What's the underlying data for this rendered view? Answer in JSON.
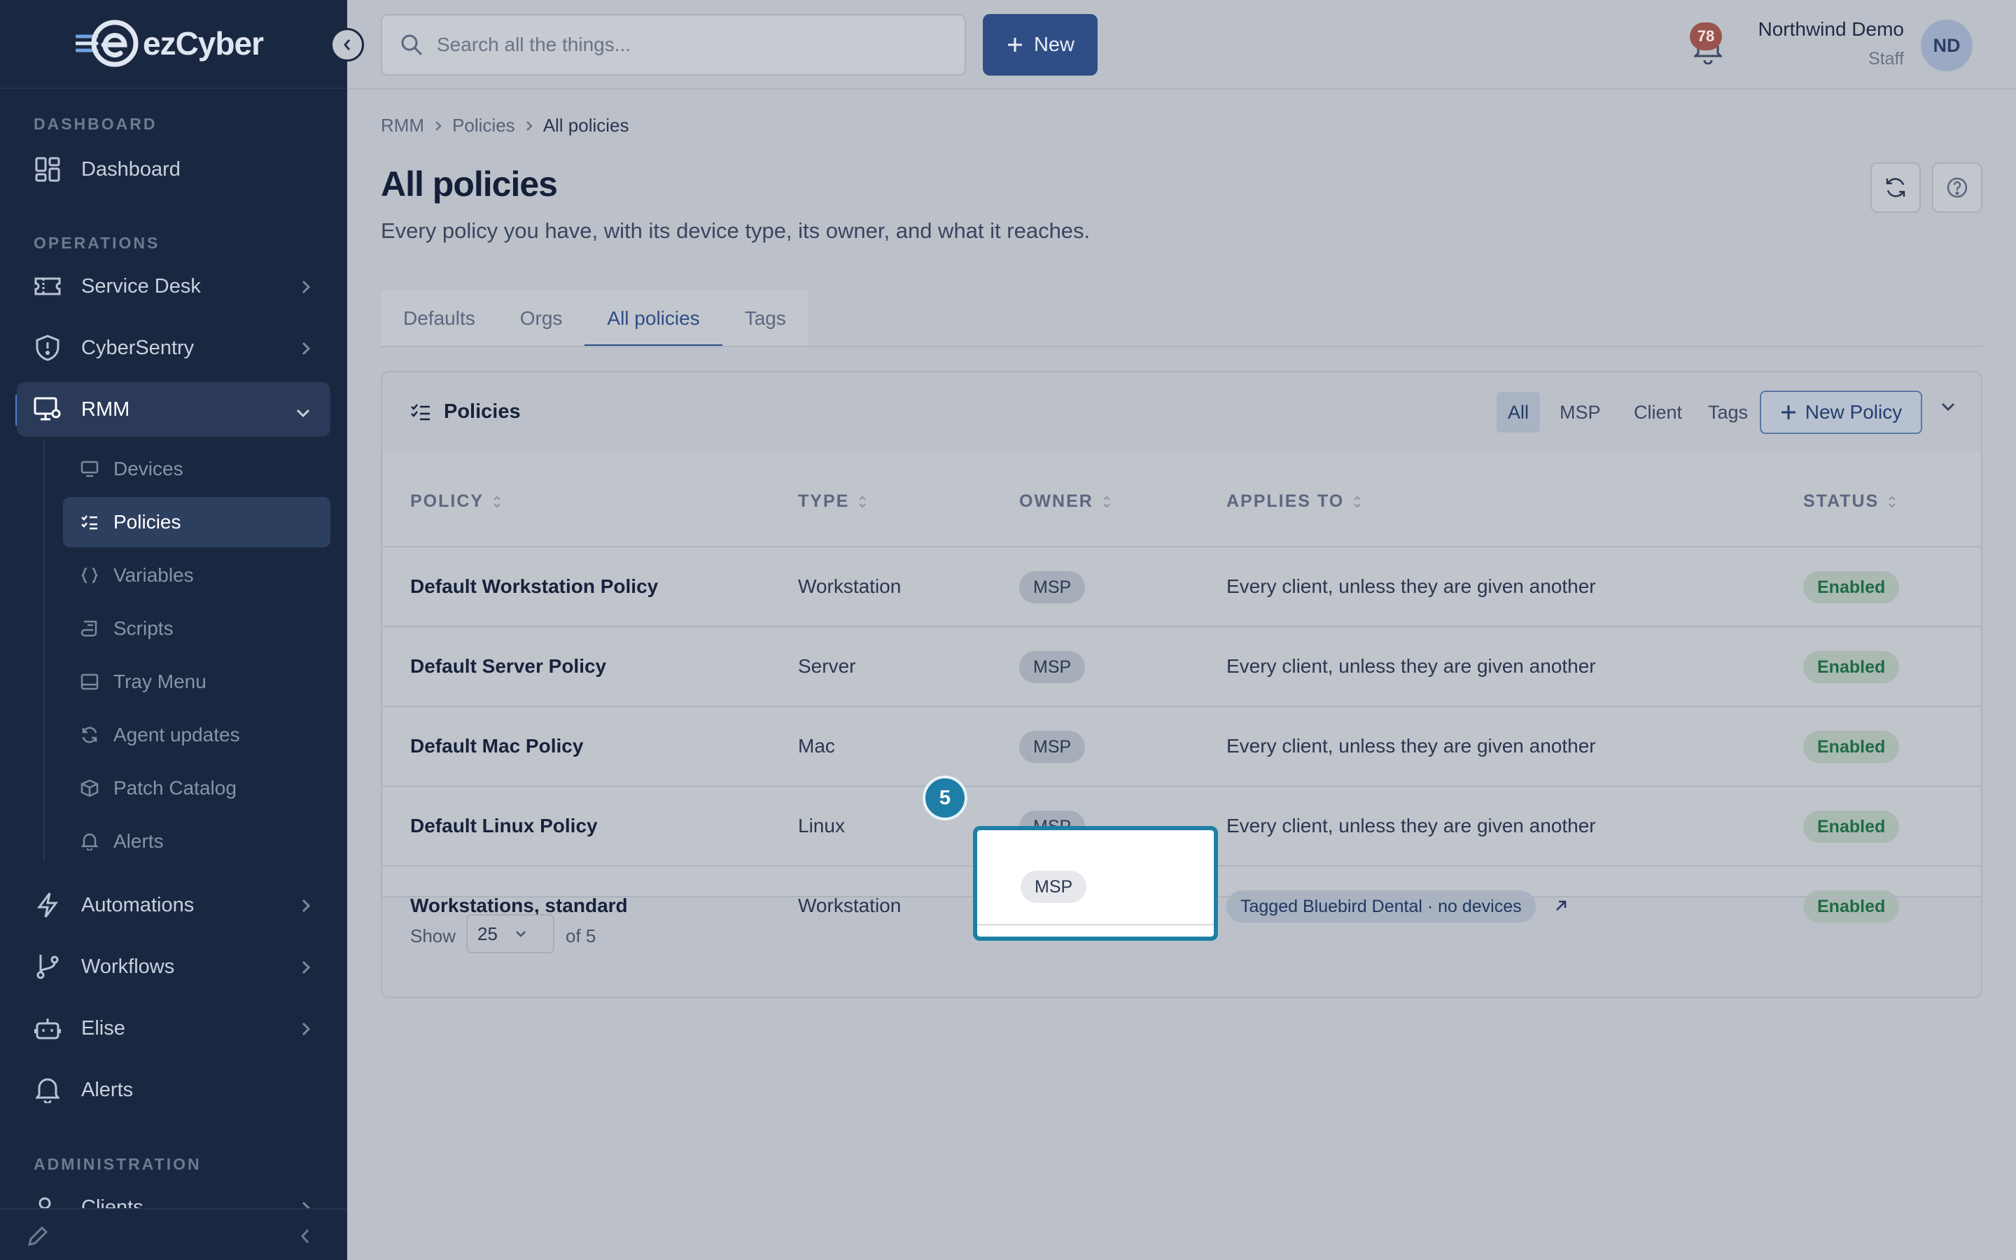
{
  "brand": {
    "name": "ezCyber"
  },
  "sidebar": {
    "sections": {
      "dashboard": "DASHBOARD",
      "operations": "OPERATIONS",
      "administration": "ADMINISTRATION"
    },
    "items": {
      "dashboard": "Dashboard",
      "service_desk": "Service Desk",
      "cybersentry": "CyberSentry",
      "rmm": "RMM",
      "automations": "Automations",
      "workflows": "Workflows",
      "elise": "Elise",
      "alerts": "Alerts",
      "clients": "Clients"
    },
    "rmm_sub": {
      "devices": "Devices",
      "policies": "Policies",
      "variables": "Variables",
      "scripts": "Scripts",
      "tray_menu": "Tray Menu",
      "agent_updates": "Agent updates",
      "patch_catalog": "Patch Catalog",
      "alerts": "Alerts"
    }
  },
  "topbar": {
    "search_placeholder": "Search all the things...",
    "new_label": "New",
    "notification_count": "78",
    "user_name": "Northwind Demo",
    "user_role": "Staff",
    "avatar_initials": "ND"
  },
  "breadcrumb": [
    "RMM",
    "Policies",
    "All policies"
  ],
  "page": {
    "title": "All policies",
    "subtitle": "Every policy you have, with its device type, its owner, and what it reaches."
  },
  "tabs": [
    "Defaults",
    "Orgs",
    "All policies",
    "Tags"
  ],
  "card": {
    "title": "Policies",
    "filters": [
      "All",
      "MSP",
      "Client",
      "Tags"
    ],
    "new_policy_label": "New Policy",
    "columns": {
      "policy": "POLICY",
      "type": "TYPE",
      "owner": "OWNER",
      "applies_to": "APPLIES TO",
      "status": "STATUS"
    },
    "rows": [
      {
        "policy": "Default Workstation Policy",
        "type": "Workstation",
        "owner": "MSP",
        "applies_to": "Every client, unless they are given another",
        "status": "Enabled"
      },
      {
        "policy": "Default Server Policy",
        "type": "Server",
        "owner": "MSP",
        "applies_to": "Every client, unless they are given another",
        "status": "Enabled"
      },
      {
        "policy": "Default Mac Policy",
        "type": "Mac",
        "owner": "MSP",
        "applies_to": "Every client, unless they are given another",
        "status": "Enabled"
      },
      {
        "policy": "Default Linux Policy",
        "type": "Linux",
        "owner": "MSP",
        "applies_to": "Every client, unless they are given another",
        "status": "Enabled"
      },
      {
        "policy": "Workstations, standard",
        "type": "Workstation",
        "owner": "MSP",
        "applies_to": "Tagged Bluebird Dental · no devices",
        "status": "Enabled"
      }
    ],
    "footer": {
      "show_label": "Show",
      "page_size": "25",
      "of_label": "of 5"
    }
  },
  "tour": {
    "step": "5"
  }
}
